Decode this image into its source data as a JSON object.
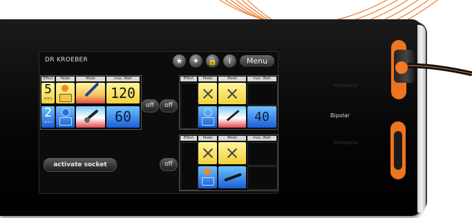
{
  "header": {
    "title": "DR KROEBER",
    "menu_label": "Menu"
  },
  "columns": {
    "effect": "Effect",
    "pedal": "Pedal",
    "mode": "Mode",
    "max_watt": "max. Watt"
  },
  "left_panel": {
    "row1": {
      "effect_value": "5",
      "effect_unit": "mns-s",
      "watt": "120"
    },
    "row2": {
      "effect_value": "2",
      "effect_unit": "mns-s",
      "watt": "60"
    }
  },
  "right_panel_top": {
    "watt": "40"
  },
  "buttons": {
    "off": "off",
    "activate_socket": "activate socket"
  },
  "device": {
    "bipolar_label": "Bipolar",
    "socket_label_1": "Monopolar",
    "socket_label_2": "Monopolar"
  },
  "icons": {
    "star": "star-icon",
    "tools": "tools-icon",
    "lock": "lock-icon",
    "info": "info-icon"
  },
  "colors": {
    "yellow": "#f2d23a",
    "blue": "#1b5fd6",
    "orange": "#f07a20"
  }
}
